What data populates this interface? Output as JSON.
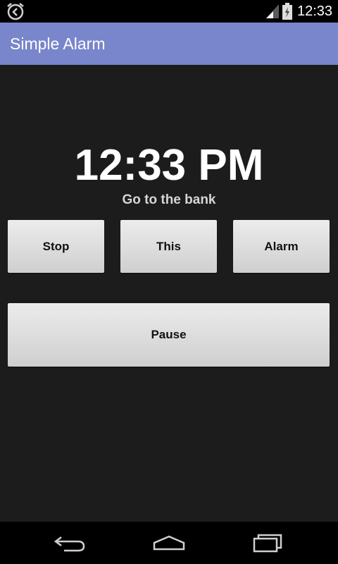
{
  "status_bar": {
    "time": "12:33",
    "icons": [
      "alarm-icon",
      "signal-icon",
      "battery-icon"
    ]
  },
  "action_bar": {
    "title": "Simple Alarm",
    "color": "#7986cb"
  },
  "alarm": {
    "time": "12:33 PM",
    "label": "Go to the bank"
  },
  "buttons": {
    "stop": "Stop",
    "this": "This",
    "alarm": "Alarm",
    "pause": "Pause"
  },
  "nav_bar": {
    "icons": [
      "back-icon",
      "home-icon",
      "recents-icon"
    ]
  }
}
